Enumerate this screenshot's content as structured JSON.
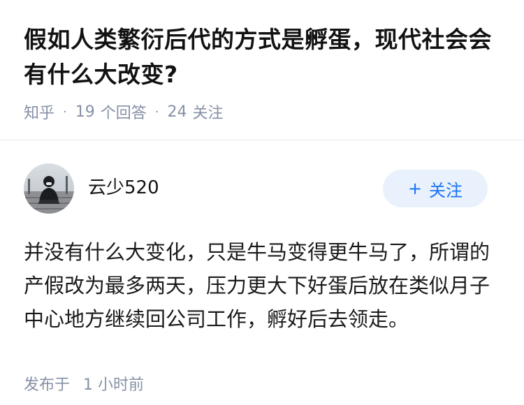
{
  "question": {
    "title": "假如人类繁衍后代的方式是孵蛋，现代社会会有什么大改变?",
    "source": "知乎",
    "answer_count": "19",
    "answer_label": "个回答",
    "follower_count": "24",
    "follower_label": "关注"
  },
  "answer": {
    "author_name": "云少520",
    "follow_button_plus": "+",
    "follow_button_label": "关注",
    "content": "并没有什么大变化，只是牛马变得更牛马了，所谓的产假改为最多两天，压力更大下好蛋后放在类似月子中心地方继续回公司工作，孵好后去领走。",
    "published_label": "发布于",
    "published_time": "1 小时前"
  },
  "colors": {
    "meta_gray": "#8590a6",
    "follow_blue": "#1772f6",
    "follow_bg": "#e8f1fc"
  }
}
